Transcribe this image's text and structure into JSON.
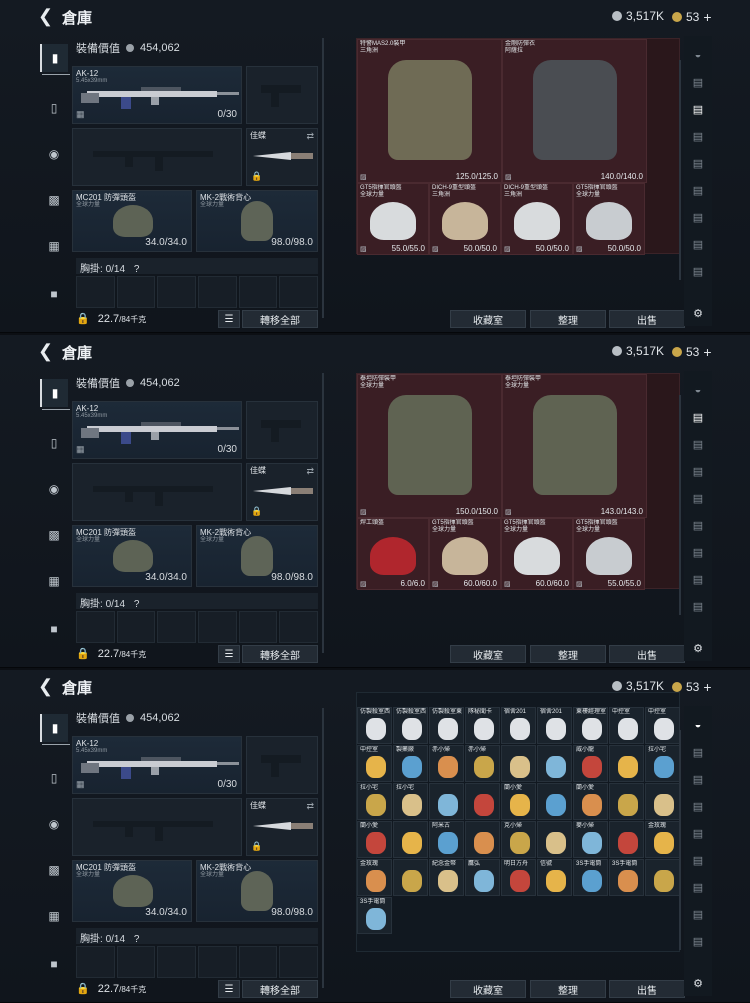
{
  "header": {
    "back_icon": "back-arrow-icon",
    "title": "倉庫",
    "silver": "3,517K",
    "gold": "53",
    "plus": "+"
  },
  "left_tabs": [
    "pistol-icon",
    "vest-icon",
    "helmet-icon",
    "backpack-icon",
    "bag-icon",
    "toolbox-icon"
  ],
  "loadout": {
    "value_label": "裝備價值",
    "value": "454,062",
    "primary": {
      "name": "AK-12",
      "sub": "5.45x39mm",
      "ammo": "0/30"
    },
    "melee": {
      "name": "佳蝶"
    },
    "helmet": {
      "name": "MC201 防彈頭盔",
      "sub": "全球力量",
      "dur": "34.0/34.0"
    },
    "vest": {
      "name": "MK-2戰術背心",
      "sub": "全球力量",
      "dur": "98.0/98.0"
    },
    "chest_label": "胸掛:",
    "chest_count": "0/14",
    "chest_q": "?",
    "weight": "22.7",
    "weight_max": "/84千克",
    "move_all": "轉移全部"
  },
  "stash_buttons": {
    "collection": "收藏室",
    "sort": "整理",
    "sell": "出售"
  },
  "panels": [
    {
      "items": [
        {
          "name": "特警MAS2.0裝甲",
          "sub": "三角洲",
          "dur": "125.0/125.0"
        },
        {
          "name": "金剛防彈衣",
          "sub": "阿薩拉",
          "dur": "140.0/140.0"
        },
        {
          "name": "GT5指揮官頭盔",
          "sub": "全球力量",
          "dur": "55.0/55.0"
        },
        {
          "name": "DICH-9重型頭盔",
          "sub": "三角洲",
          "dur": "50.0/50.0"
        },
        {
          "name": "DICH-9重型頭盔",
          "sub": "三角洲",
          "dur": "50.0/50.0"
        },
        {
          "name": "GT5指揮官頭盔",
          "sub": "全球力量",
          "dur": "50.0/50.0"
        }
      ]
    },
    {
      "items": [
        {
          "name": "泰坦防彈裝甲",
          "sub": "全球力量",
          "dur": "150.0/150.0"
        },
        {
          "name": "泰坦防彈裝甲",
          "sub": "全球力量",
          "dur": "143.0/143.0"
        },
        {
          "name": "焊工頭盔",
          "sub": "",
          "dur": "6.0/6.0"
        },
        {
          "name": "GT5指揮官頭盔",
          "sub": "全球力量",
          "dur": "60.0/60.0"
        },
        {
          "name": "GT5指揮官頭盔",
          "sub": "全球力量",
          "dur": "60.0/60.0"
        },
        {
          "name": "GT5指揮官頭盔",
          "sub": "全球力量",
          "dur": "55.0/55.0"
        }
      ]
    },
    {
      "rows": [
        [
          "仿製殺室西",
          "仿製殺室西",
          "仿製殺室東",
          "隊秘聞卡",
          "宿舍201",
          "宿舍201",
          "東樓經理室",
          "中控室",
          "中控室"
        ],
        [
          "中控室",
          "製藥廠",
          "赤小帰",
          "赤小帰",
          "",
          "",
          "威小龍",
          "",
          "拉小宅"
        ],
        [
          "拉小宅",
          "拉小宅",
          "",
          "",
          "蘭小愛",
          "",
          "蘭小愛",
          "",
          ""
        ],
        [
          "蘭小愛",
          "",
          "阿米古",
          "",
          "克小帰",
          "",
          "麥小帰",
          "",
          "金玫瑰"
        ],
        [
          "金玫瑰",
          "",
          "紀念金幣",
          "鷹弘",
          "明日方舟",
          "信號",
          "3S手電筒",
          "3S手電筒",
          ""
        ],
        [
          "3S手電筒"
        ]
      ]
    }
  ],
  "right_tabs": [
    "safe-icon",
    "case-icon",
    "case-icon",
    "case-icon",
    "case-icon",
    "case-icon",
    "case-icon",
    "case-icon",
    "case-icon"
  ],
  "settings_icon": "gear-icon"
}
